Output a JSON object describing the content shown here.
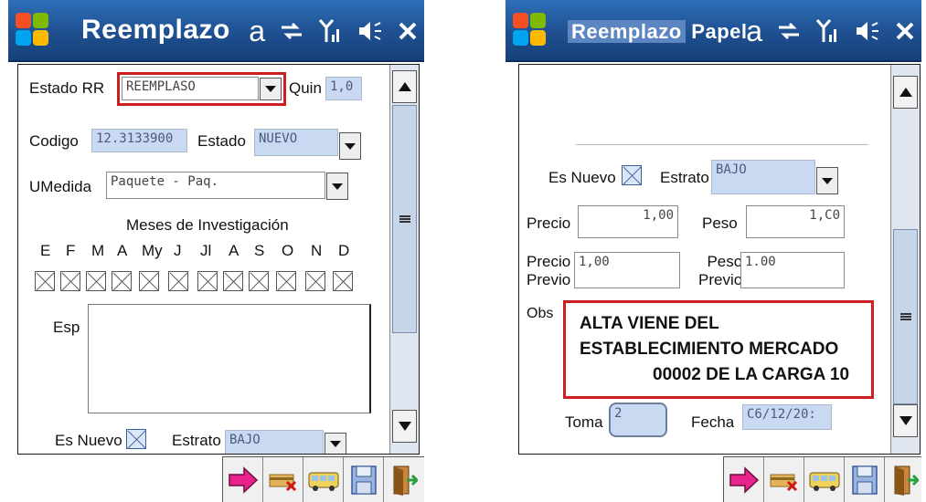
{
  "screen1": {
    "title": "Reemplazo",
    "status_icons": [
      "keyboard-icon",
      "sync-icon",
      "signal-icon",
      "volume-icon",
      "close-icon"
    ],
    "estado_rr": {
      "label": "Estado RR",
      "value": "REEMPLASO"
    },
    "quin": {
      "label": "Quin",
      "value": "1,0"
    },
    "codigo": {
      "label": "Codigo",
      "value": "12.3133900"
    },
    "estado": {
      "label": "Estado",
      "value": "NUEVO"
    },
    "umedida": {
      "label": "UMedida",
      "value": "Paquete - Paq."
    },
    "meses_title": "Meses de Investigación",
    "meses": [
      "E",
      "F",
      "M",
      "A",
      "My",
      "J",
      "Jl",
      "A",
      "S",
      "O",
      "N",
      "D"
    ],
    "esp": {
      "label": "Esp"
    },
    "es_nuevo": {
      "label": "Es Nuevo"
    },
    "estrato": {
      "label": "Estrato",
      "value": "BAJO"
    }
  },
  "screen2": {
    "title_part1": "Reemplazo",
    "title_part2": "Papel",
    "status_icons": [
      "keyboard-icon",
      "sync-icon",
      "signal-icon",
      "volume-icon",
      "close-icon"
    ],
    "es_nuevo": {
      "label": "Es Nuevo"
    },
    "estrato": {
      "label": "Estrato",
      "value": "BAJO"
    },
    "precio": {
      "label": "Precio",
      "value": "1,00"
    },
    "peso": {
      "label": "Peso",
      "value": "1,C0"
    },
    "precio_previo": {
      "label1": "Precio",
      "label2": "Previo",
      "value": "1,00"
    },
    "peso_previo": {
      "label1": "Peso",
      "label2": "Previo",
      "value": "1.00"
    },
    "obs": {
      "label": "Obs",
      "line1": "ALTA VIENE DEL",
      "line2": "ESTABLECIMIENTO MERCADO",
      "line3": "00002 DE LA CARGA 10"
    },
    "toma": {
      "label": "Toma",
      "value": "2"
    },
    "fecha": {
      "label": "Fecha",
      "value": "C6/12/20:"
    }
  },
  "toolbar_icons": [
    "arrow-right-icon",
    "delete-card-icon",
    "bus-icon",
    "save-icon",
    "exit-door-icon"
  ],
  "colors": {
    "titlebar": "#1e4f90",
    "field_bg": "#c9d9f2",
    "highlight_red": "#cc2020"
  }
}
